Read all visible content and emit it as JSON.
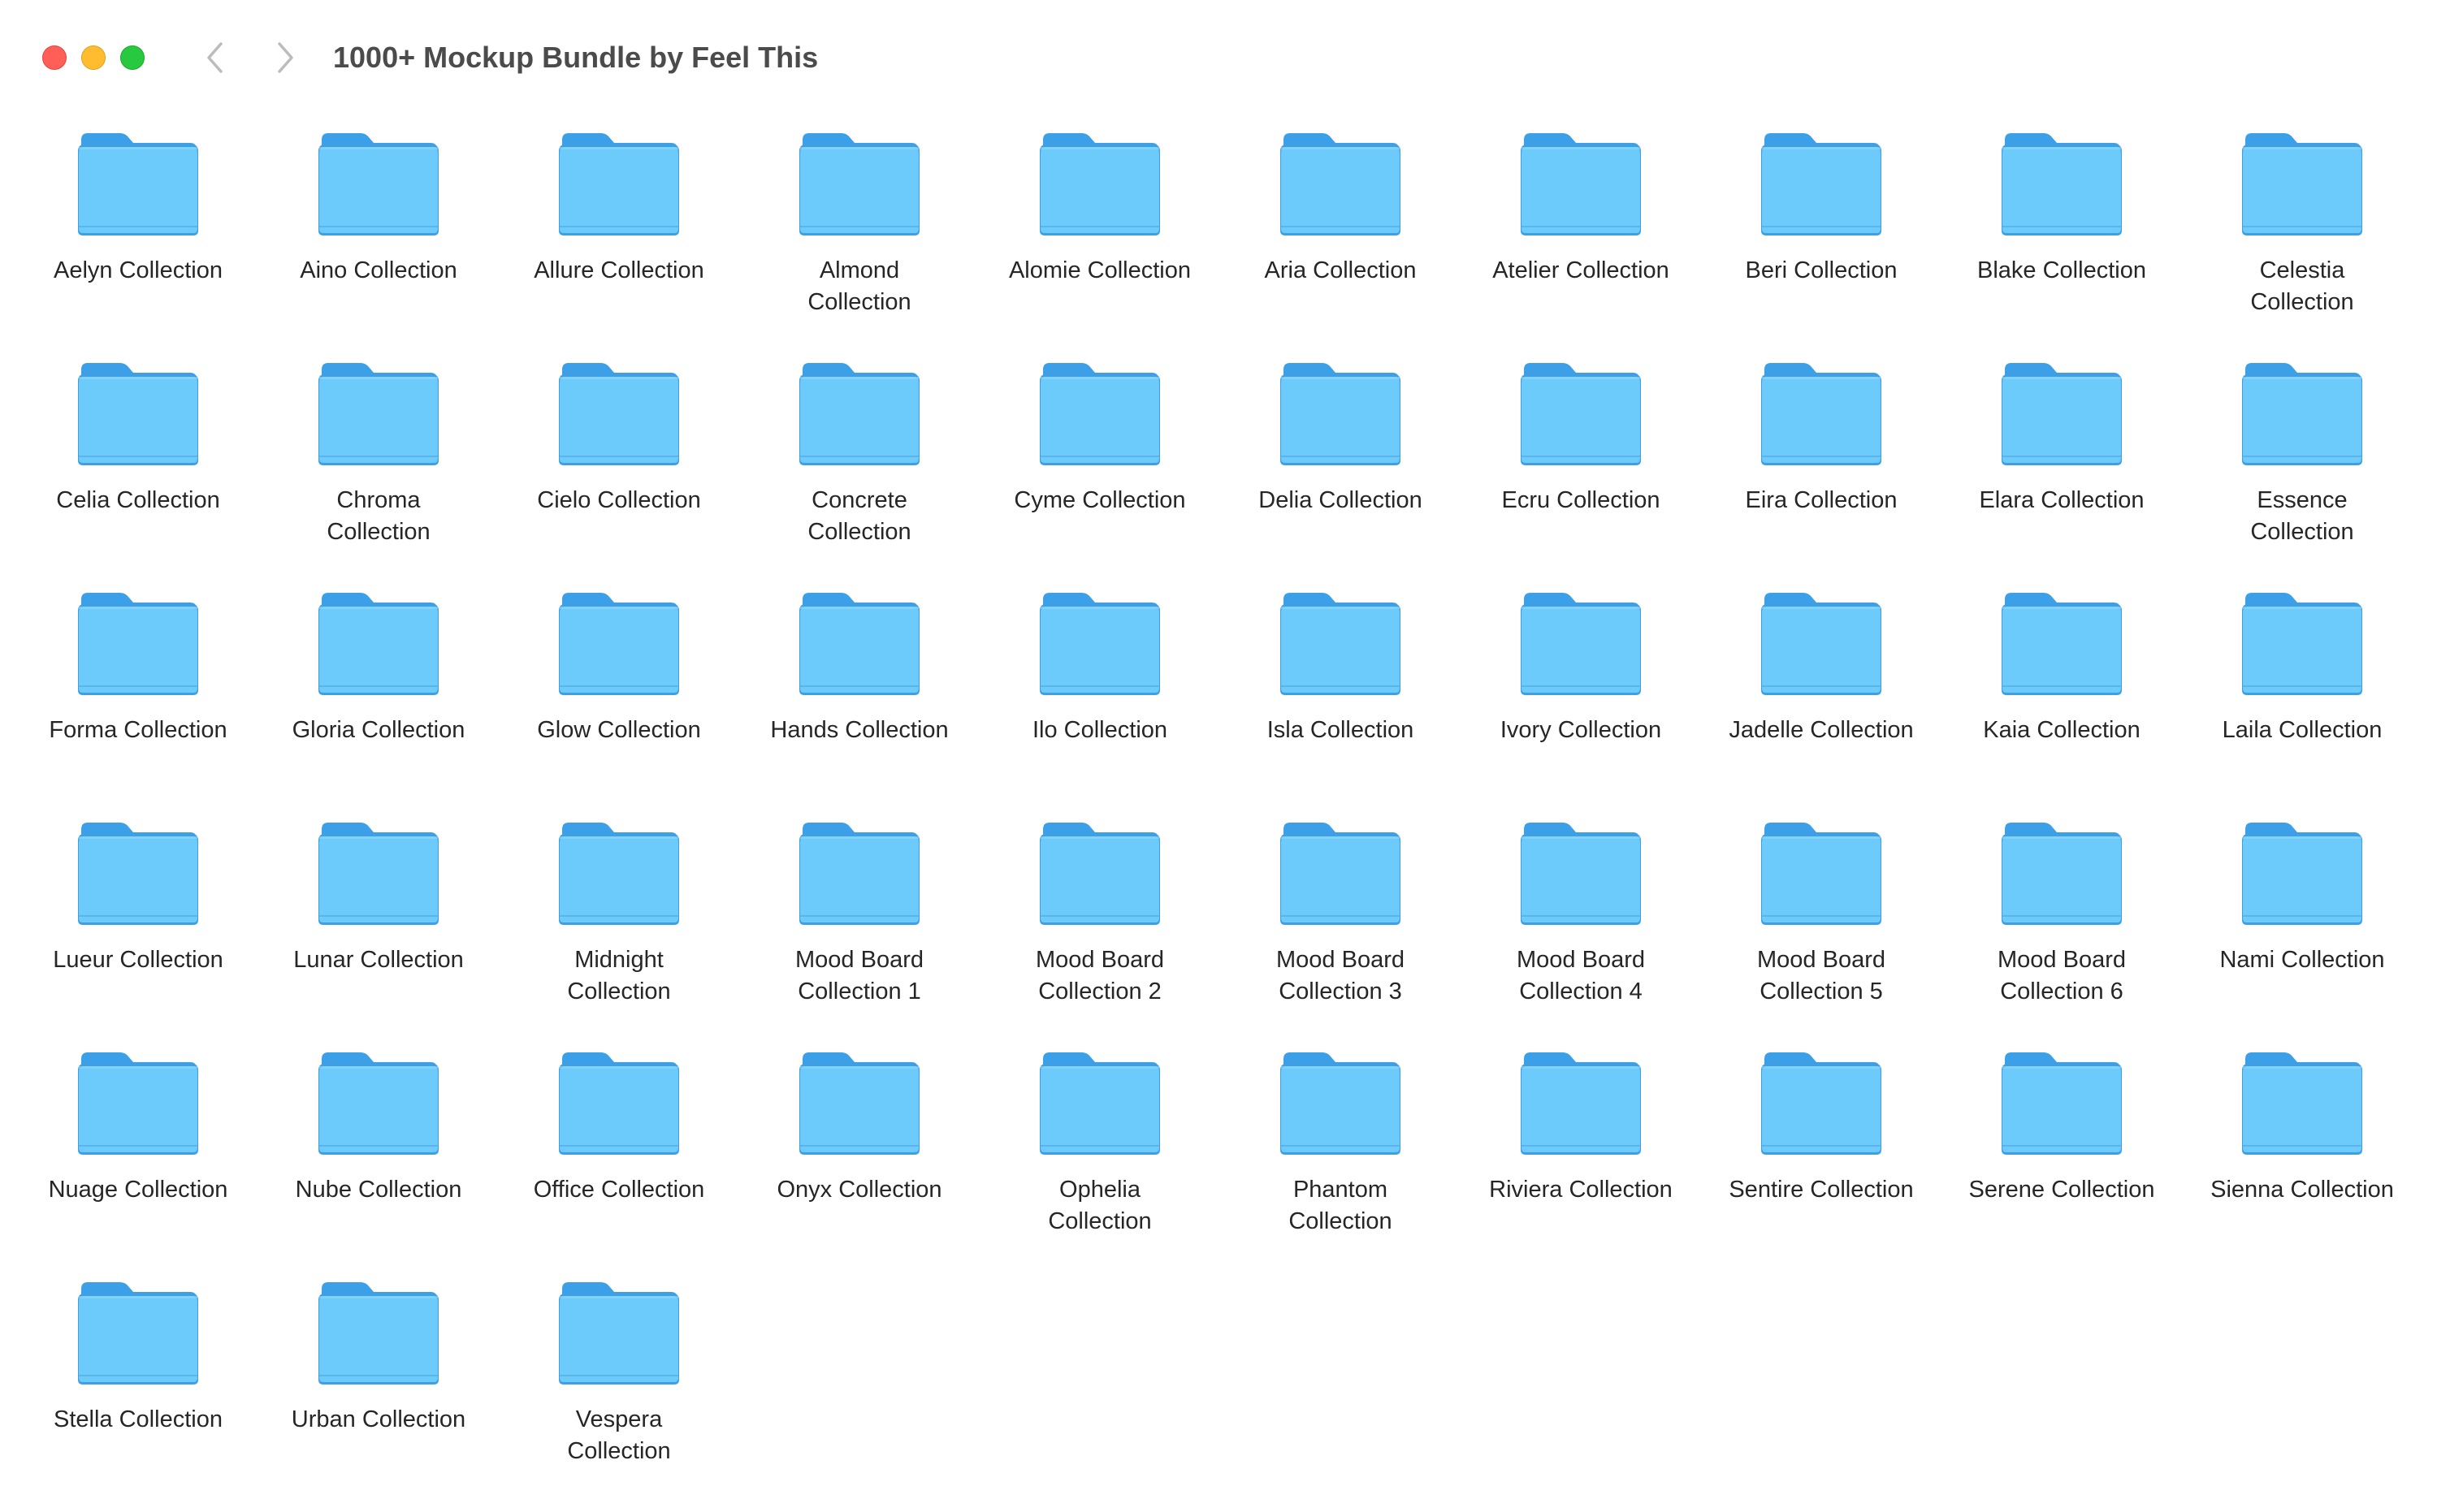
{
  "window": {
    "title": "1000+ Mockup Bundle by Feel This"
  },
  "icons": {
    "back": "chevron-left-icon",
    "forward": "chevron-right-icon",
    "folder": "folder-icon"
  },
  "colors": {
    "folder_body": "#6ccbfb",
    "folder_top": "#3ba0e8",
    "close": "#ff5f57",
    "minimize": "#febc2e",
    "maximize": "#28c840"
  },
  "folders": [
    {
      "line1": "Aelyn Collection",
      "line2": ""
    },
    {
      "line1": "Aino Collection",
      "line2": ""
    },
    {
      "line1": "Allure Collection",
      "line2": ""
    },
    {
      "line1": "Almond",
      "line2": "Collection"
    },
    {
      "line1": "Alomie Collection",
      "line2": ""
    },
    {
      "line1": "Aria Collection",
      "line2": ""
    },
    {
      "line1": "Atelier Collection",
      "line2": ""
    },
    {
      "line1": "Beri Collection",
      "line2": ""
    },
    {
      "line1": "Blake Collection",
      "line2": ""
    },
    {
      "line1": "Celestia",
      "line2": "Collection"
    },
    {
      "line1": "Celia Collection",
      "line2": ""
    },
    {
      "line1": "Chroma",
      "line2": "Collection"
    },
    {
      "line1": "Cielo Collection",
      "line2": ""
    },
    {
      "line1": "Concrete",
      "line2": "Collection"
    },
    {
      "line1": "Cyme Collection",
      "line2": ""
    },
    {
      "line1": "Delia Collection",
      "line2": ""
    },
    {
      "line1": "Ecru Collection",
      "line2": ""
    },
    {
      "line1": "Eira Collection",
      "line2": ""
    },
    {
      "line1": "Elara Collection",
      "line2": ""
    },
    {
      "line1": "Essence",
      "line2": "Collection"
    },
    {
      "line1": "Forma Collection",
      "line2": ""
    },
    {
      "line1": "Gloria Collection",
      "line2": ""
    },
    {
      "line1": "Glow Collection",
      "line2": ""
    },
    {
      "line1": "Hands Collection",
      "line2": ""
    },
    {
      "line1": "Ilo Collection",
      "line2": ""
    },
    {
      "line1": "Isla Collection",
      "line2": ""
    },
    {
      "line1": "Ivory Collection",
      "line2": ""
    },
    {
      "line1": "Jadelle Collection",
      "line2": ""
    },
    {
      "line1": "Kaia Collection",
      "line2": ""
    },
    {
      "line1": "Laila Collection",
      "line2": ""
    },
    {
      "line1": "Lueur Collection",
      "line2": ""
    },
    {
      "line1": "Lunar Collection",
      "line2": ""
    },
    {
      "line1": "Midnight",
      "line2": "Collection"
    },
    {
      "line1": "Mood Board",
      "line2": "Collection 1"
    },
    {
      "line1": "Mood Board",
      "line2": "Collection 2"
    },
    {
      "line1": "Mood Board",
      "line2": "Collection 3"
    },
    {
      "line1": "Mood Board",
      "line2": "Collection 4"
    },
    {
      "line1": "Mood Board",
      "line2": "Collection 5"
    },
    {
      "line1": "Mood Board",
      "line2": "Collection 6"
    },
    {
      "line1": "Nami Collection",
      "line2": ""
    },
    {
      "line1": "Nuage Collection",
      "line2": ""
    },
    {
      "line1": "Nube Collection",
      "line2": ""
    },
    {
      "line1": "Office Collection",
      "line2": ""
    },
    {
      "line1": "Onyx Collection",
      "line2": ""
    },
    {
      "line1": "Ophelia",
      "line2": "Collection"
    },
    {
      "line1": "Phantom",
      "line2": "Collection"
    },
    {
      "line1": "Riviera Collection",
      "line2": ""
    },
    {
      "line1": "Sentire Collection",
      "line2": ""
    },
    {
      "line1": "Serene Collection",
      "line2": ""
    },
    {
      "line1": "Sienna Collection",
      "line2": ""
    },
    {
      "line1": "Stella Collection",
      "line2": ""
    },
    {
      "line1": "Urban Collection",
      "line2": ""
    },
    {
      "line1": "Vespera",
      "line2": "Collection"
    }
  ]
}
